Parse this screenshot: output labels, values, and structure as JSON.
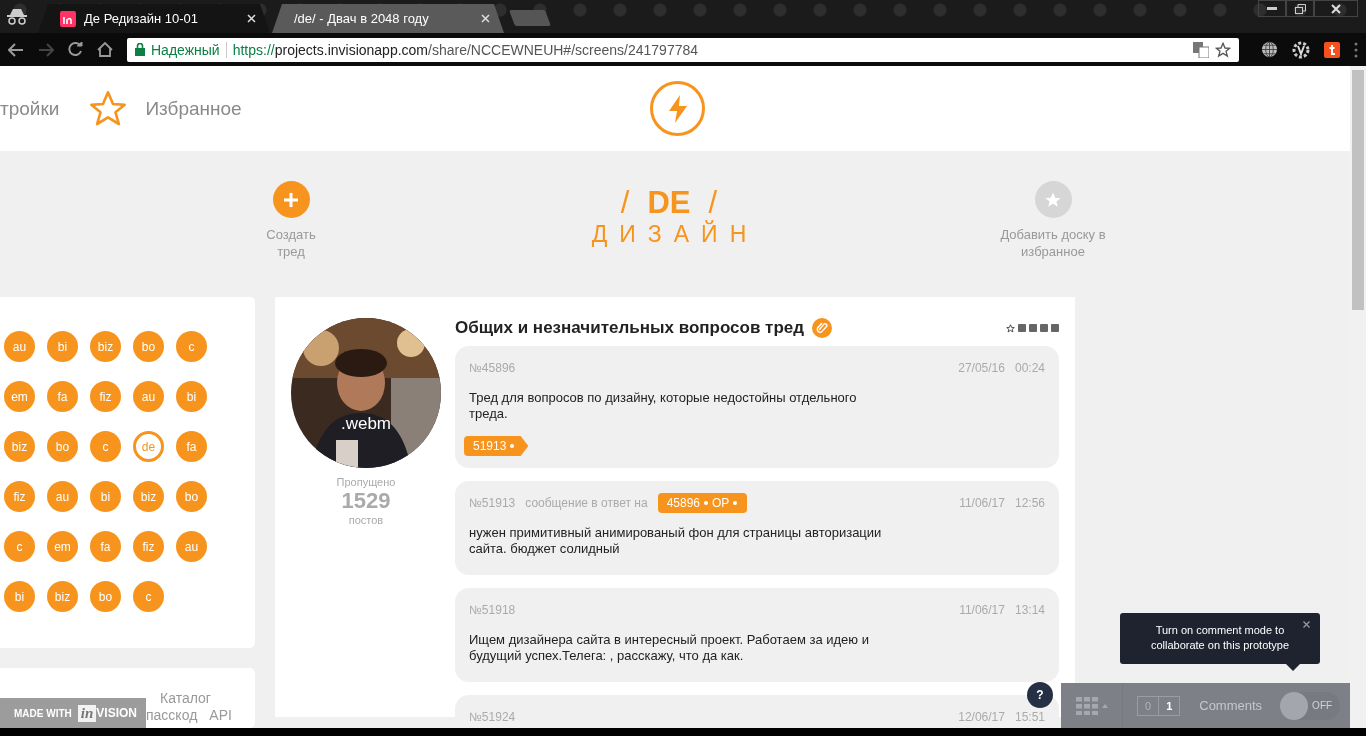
{
  "browser": {
    "tabs": [
      {
        "title": "Де Редизайн 10-01",
        "selected": true,
        "kind": "invision"
      },
      {
        "title": "/de/ - Двач в 2048 году",
        "selected": false,
        "kind": "plain"
      }
    ],
    "address": {
      "security": "Надежный",
      "scheme": "https://",
      "host": "projects.invisionapp.com",
      "path": "/share/NCCEWNEUH#/screens/241797784"
    }
  },
  "nav": [
    {
      "label": "тройки",
      "kind": "text"
    },
    {
      "label": "Избранное",
      "kind": "star"
    }
  ],
  "board": {
    "create_label": "Создать тред",
    "slash_left": "/",
    "code": "DE",
    "slash_right": "/",
    "name": "ДИЗАЙН",
    "favorite_label": "Добавить доску в избранное"
  },
  "boards": [
    {
      "label": "au",
      "selected": false
    },
    {
      "label": "bi",
      "selected": false
    },
    {
      "label": "biz",
      "selected": false
    },
    {
      "label": "bo",
      "selected": false
    },
    {
      "label": "c",
      "selected": false
    },
    {
      "label": "em",
      "selected": false
    },
    {
      "label": "fa",
      "selected": false
    },
    {
      "label": "fiz",
      "selected": false
    },
    {
      "label": "au",
      "selected": false
    },
    {
      "label": "bi",
      "selected": false
    },
    {
      "label": "biz",
      "selected": false
    },
    {
      "label": "bo",
      "selected": false
    },
    {
      "label": "c",
      "selected": false
    },
    {
      "label": "de",
      "selected": true
    },
    {
      "label": "fa",
      "selected": false
    },
    {
      "label": "fiz",
      "selected": false
    },
    {
      "label": "au",
      "selected": false
    },
    {
      "label": "bi",
      "selected": false
    },
    {
      "label": "biz",
      "selected": false
    },
    {
      "label": "bo",
      "selected": false
    },
    {
      "label": "c",
      "selected": false
    },
    {
      "label": "em",
      "selected": false
    },
    {
      "label": "fa",
      "selected": false
    },
    {
      "label": "fiz",
      "selected": false
    },
    {
      "label": "au",
      "selected": false
    },
    {
      "label": "bi",
      "selected": false
    },
    {
      "label": "biz",
      "selected": false
    },
    {
      "label": "bo",
      "selected": false
    },
    {
      "label": "c",
      "selected": false
    }
  ],
  "thread": {
    "title": "Общих и незначительных вопросов тред",
    "media_label": ".webm",
    "skipped_label": "Пропущено",
    "skipped_count": "1529",
    "skipped_unit": "постов",
    "posts": [
      {
        "number": "№45896",
        "date": "27/05/16",
        "time": "00:24",
        "text": "Тред для вопросов по дизайну, которые недостойны отдельного треда.",
        "replies": [
          "51913"
        ]
      },
      {
        "number": "№51913",
        "reply_label": "сообщение в ответ на",
        "reply_to": "45896",
        "reply_op": "OP",
        "date": "11/06/17",
        "time": "12:56",
        "text": "нужен примитивный анимированый фон для страницы авторизации сайта. бюджет солидный"
      },
      {
        "number": "№51918",
        "date": "11/06/17",
        "time": "13:14",
        "text": "Ищем дизайнера сайта в интересный проект. Работаем за идею и будущий успех.Телега: , расскажу, что да как."
      },
      {
        "number": "№51924",
        "date": "12/06/17",
        "time": "15:51"
      }
    ]
  },
  "footer": [
    [
      "Каталог"
    ],
    [
      "пасскод",
      "API"
    ]
  ],
  "badge": {
    "label": "MADE WITH",
    "logo": "in",
    "brand": "VISION"
  },
  "help": "?",
  "tooltip": "Turn on comment mode to collaborate on this prototype",
  "invision": {
    "count_a": "0",
    "count_b": "1",
    "comments": "Comments",
    "toggle_on": false,
    "toggle_label": "OFF"
  }
}
